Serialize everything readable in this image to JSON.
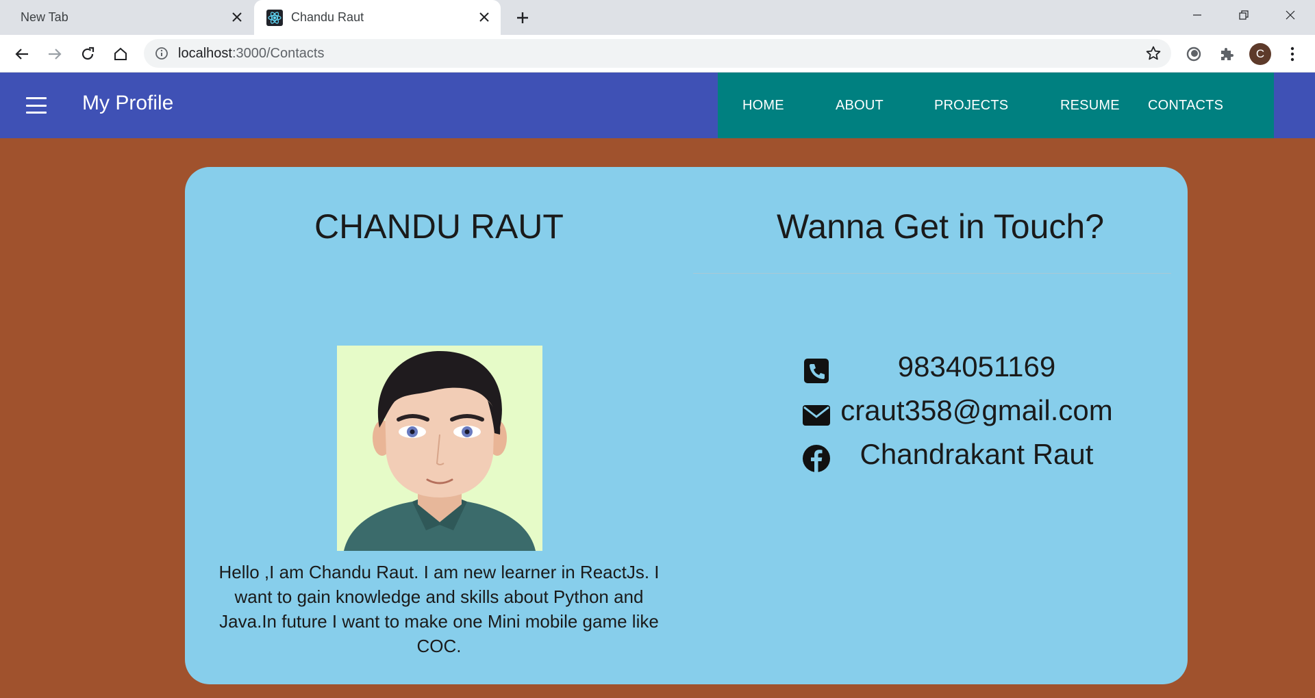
{
  "browser": {
    "tabs": [
      {
        "label": "New Tab",
        "active": false
      },
      {
        "label": "Chandu Raut",
        "active": true
      }
    ],
    "url_host": "localhost",
    "url_path": ":3000/Contacts",
    "profile_initial": "C"
  },
  "appbar": {
    "brand": "My Profile",
    "nav": [
      "HOME",
      "ABOUT",
      "PROJECTS",
      "RESUME",
      "CONTACTS"
    ]
  },
  "profile": {
    "name": "CHANDU RAUT",
    "bio": "Hello ,I am Chandu Raut. I am new learner in ReactJs. I want to gain knowledge and skills about Python and Java.In future I want to make one Mini mobile game like COC."
  },
  "contact": {
    "heading": "Wanna Get in Touch?",
    "phone": "9834051169",
    "email": "craut358@gmail.com",
    "facebook": "Chandrakant Raut"
  },
  "colors": {
    "page_bg": "#a0522d",
    "appbar": "#3f51b5",
    "nav_bg": "#008080",
    "card_bg": "#87ceeb"
  }
}
